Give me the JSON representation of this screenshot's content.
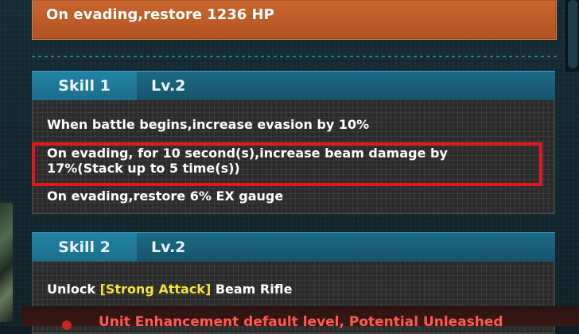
{
  "top_panel": {
    "text": "On evading,restore 1236 HP"
  },
  "skill1": {
    "name": "Skill 1",
    "level": "Lv.2",
    "lines": [
      "When battle begins,increase evasion by 10%",
      "On evading, for 10 second(s),increase beam damage by",
      "17%(Stack up to 5 time(s))",
      "On evading,restore 6% EX gauge"
    ]
  },
  "skill2": {
    "name": "Skill 2",
    "level": "Lv.2",
    "unlock_prefix": "Unlock ",
    "unlock_tag": "[Strong Attack]",
    "unlock_suffix": " Beam Rifle"
  },
  "bottom_banner": {
    "text": "Unit Enhancement default level, Potential Unleashed"
  },
  "colors": {
    "orange": "#c9662e",
    "teal": "#1c6a86",
    "highlight": "#f5e23a",
    "red_box": "#e3171c"
  }
}
